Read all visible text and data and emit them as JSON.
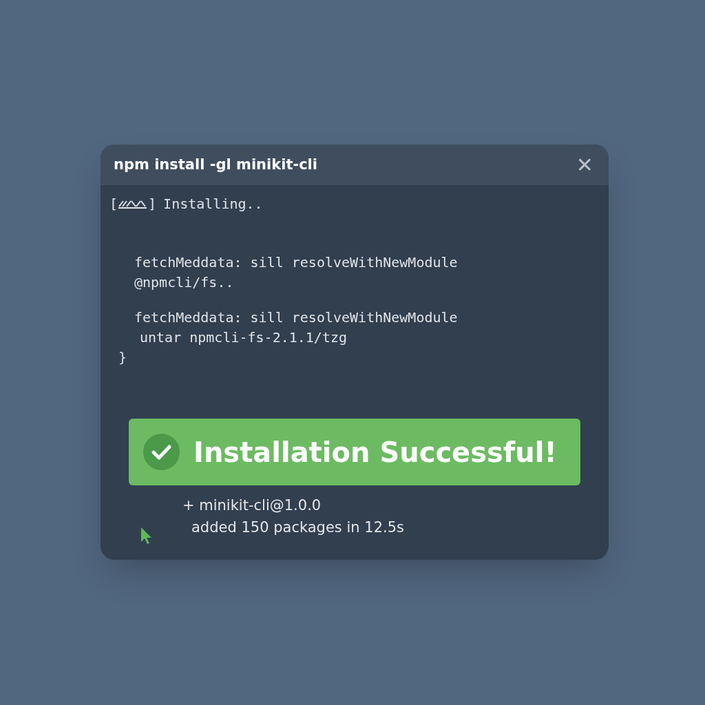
{
  "window": {
    "title": "npm install -gl minikit-cli",
    "close_glyph": "✕"
  },
  "progress": {
    "open": "[",
    "close": "]",
    "label": "Installing.."
  },
  "log": [
    {
      "kind": "detail",
      "text": "fetchMeddata: sill resolveWithNewModule"
    },
    {
      "kind": "detail",
      "text": "@npmcli/fs.."
    },
    {
      "kind": "gap",
      "text": "fetchMeddata: sill resolveWithNewModule"
    },
    {
      "kind": "sub",
      "text": "untar npmcli-fs-2.1.1/tzg"
    },
    {
      "kind": "brace",
      "text": "}"
    }
  ],
  "banner": {
    "text": "Installation Successful!"
  },
  "summary": [
    {
      "kind": "package",
      "text": "+ minikit-cli@1.0.0"
    },
    {
      "kind": "stats",
      "text": "added 150 packages in 12.5s"
    }
  ]
}
